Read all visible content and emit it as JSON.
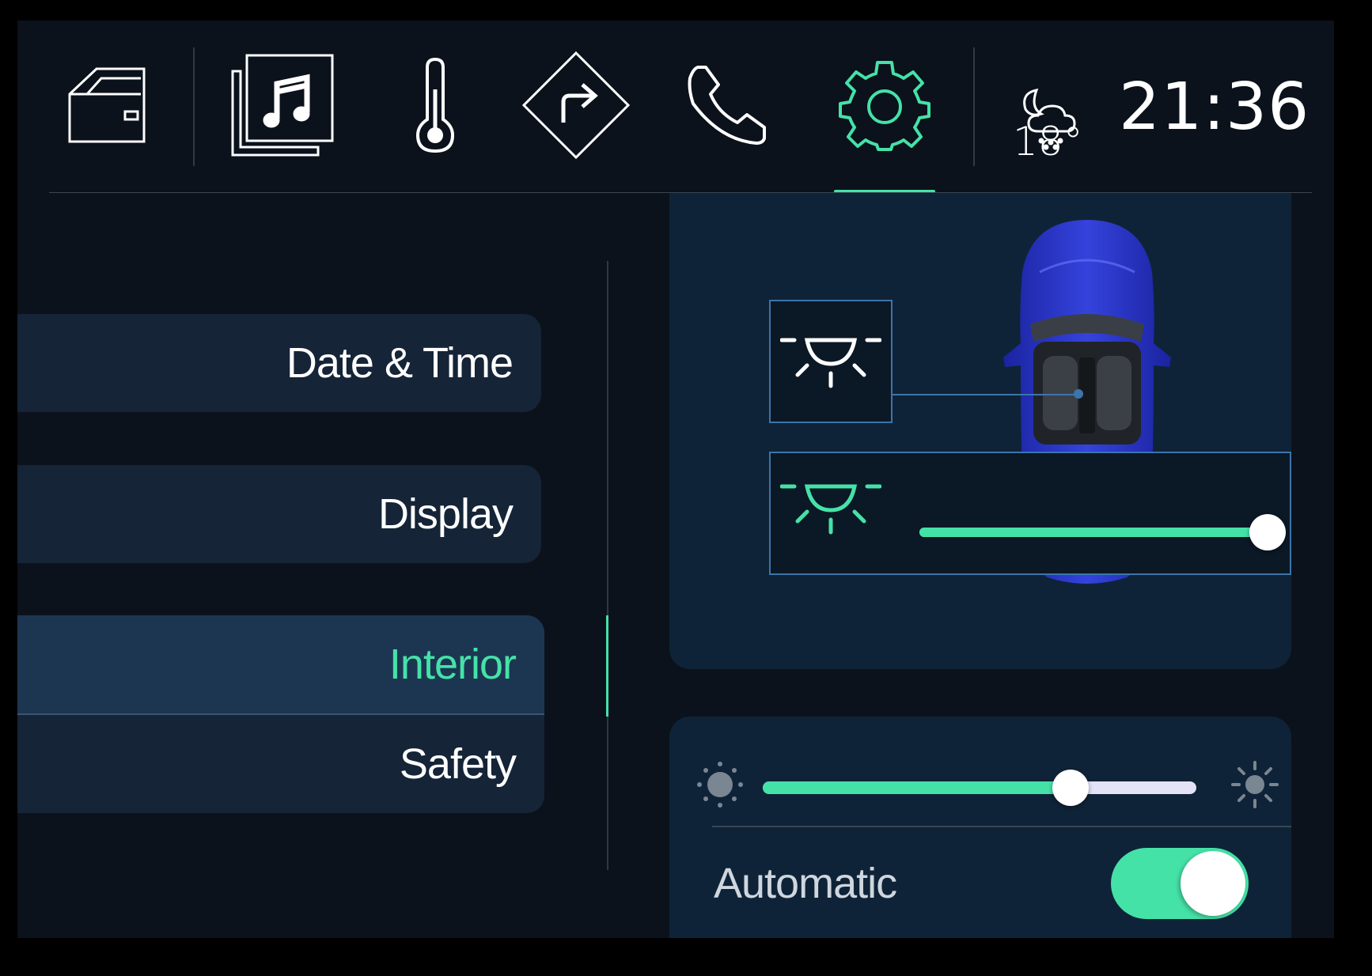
{
  "topbar": {
    "nav": [
      {
        "icon": "car-door-icon",
        "active": false
      },
      {
        "icon": "media-music-icon",
        "active": false
      },
      {
        "icon": "thermometer-icon",
        "active": false
      },
      {
        "icon": "navigation-turn-icon",
        "active": false
      },
      {
        "icon": "phone-icon",
        "active": false
      },
      {
        "icon": "gear-icon",
        "active": true
      }
    ],
    "weather_icon": "night-snow-cloud-icon",
    "temperature": "18°",
    "clock": "21:36"
  },
  "menu": {
    "items": [
      {
        "label": "Date & Time",
        "selected": false
      },
      {
        "label": "Display",
        "selected": false
      },
      {
        "label": "Interior",
        "selected": true
      },
      {
        "label": "Safety",
        "selected": false
      }
    ]
  },
  "interior": {
    "light_icon": "dome-light-icon",
    "light_level": 1.0
  },
  "brightness": {
    "level": 0.71,
    "auto_label": "Automatic",
    "automatic": true
  },
  "colors": {
    "accent": "#45e2a8",
    "background": "#0b121c",
    "card": "#0f2338",
    "menu_item": "#152437",
    "menu_selected": "#1c3652",
    "outline": "#3d74aa",
    "car_body": "#2331c4"
  }
}
